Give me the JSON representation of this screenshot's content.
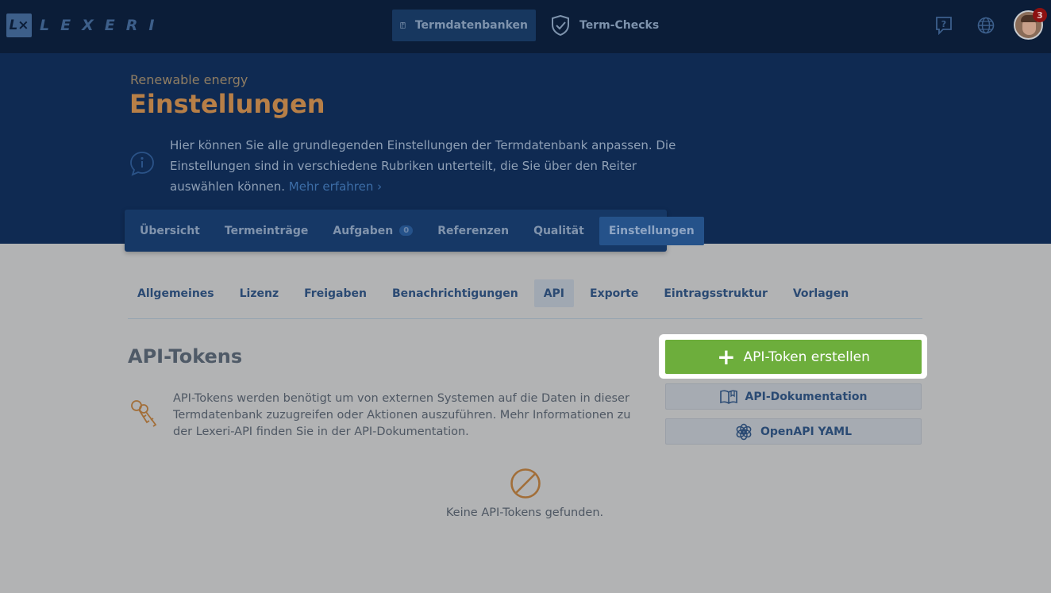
{
  "brand": {
    "logo_mark": "L×",
    "logo_text": "LEXERI"
  },
  "topnav": {
    "items": [
      {
        "label": "Termdatenbanken",
        "icon": "book-icon",
        "active": true
      },
      {
        "label": "Term-Checks",
        "icon": "shield-check-icon",
        "active": false
      }
    ],
    "help_icon": "help-icon",
    "language_icon": "globe-icon",
    "notification_count": "3"
  },
  "header": {
    "subtitle": "Renewable energy",
    "title": "Einstellungen",
    "info_text": "Hier können Sie alle grundlegenden Einstellungen der Termdatenbank anpassen. Die Einstellungen sind in verschiedene Rubriken unterteilt, die Sie über den Reiter auswählen können.",
    "info_link": "Mehr erfahren ›"
  },
  "tabs": [
    {
      "label": "Übersicht"
    },
    {
      "label": "Termeinträge"
    },
    {
      "label": "Aufgaben",
      "count": "0"
    },
    {
      "label": "Referenzen"
    },
    {
      "label": "Qualität"
    },
    {
      "label": "Einstellungen",
      "active": true
    }
  ],
  "subtabs": [
    {
      "label": "Allgemeines"
    },
    {
      "label": "Lizenz"
    },
    {
      "label": "Freigaben"
    },
    {
      "label": "Benachrichtigungen"
    },
    {
      "label": "API",
      "active": true
    },
    {
      "label": "Exporte"
    },
    {
      "label": "Eintragsstruktur"
    },
    {
      "label": "Vorlagen"
    }
  ],
  "api": {
    "title": "API-Tokens",
    "description": "API-Tokens werden benötigt um von externen Systemen auf die Daten in dieser Termdatenbank zuzugreifen oder Aktionen auszuführen. Mehr Informationen zu der Lexeri-API finden Sie in der API-Dokumentation.",
    "create_label": "API-Token erstellen",
    "docs_label": "API-Dokumentation",
    "yaml_label": "OpenAPI YAML",
    "empty_text": "Keine API-Tokens gefunden."
  },
  "colors": {
    "nav_bg": "#0b1d38",
    "header_bg": "#0f2a52",
    "accent_orange": "#b77f47",
    "create_green": "#6dae3c",
    "badge_red": "#8c1111"
  }
}
